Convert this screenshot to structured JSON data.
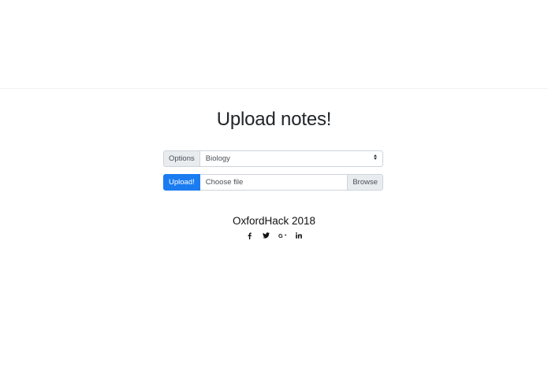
{
  "page": {
    "title": "Upload notes!"
  },
  "form": {
    "options_label": "Options",
    "subject_selected": "Biology",
    "upload_label": "Upload!",
    "file_placeholder": "Choose file",
    "browse_label": "Browse"
  },
  "footer": {
    "title": "OxfordHack 2018",
    "social_icons": [
      "facebook-icon",
      "twitter-icon",
      "google-plus-icon",
      "linkedin-icon"
    ]
  },
  "colors": {
    "primary": "#1a7cf0",
    "addon_bg": "#e9ecef",
    "border": "#ced4da"
  }
}
